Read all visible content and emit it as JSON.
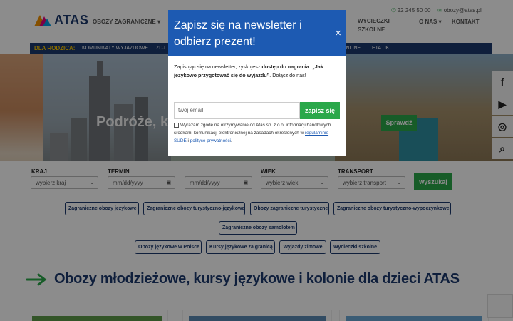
{
  "header": {
    "logo_text": "ATAS",
    "nav": [
      "OBOZY ZAGRANICZNE"
    ],
    "nav_right": [
      "WYCIECZKI",
      "SZKOLNE",
      "O NAS",
      "KONTAKT"
    ],
    "phone": "22 245 50 00",
    "email": "obozy@atas.pl"
  },
  "subnav": {
    "label": "DLA RODZICA:",
    "items": [
      "KOMUNIKATY WYJAZDOWE",
      "ZDJ",
      "ONLINE",
      "ETA UK"
    ]
  },
  "hero": {
    "text": "Podróże, kt",
    "button": "Sprawdź"
  },
  "search": {
    "kraj_label": "KRAJ",
    "kraj_value": "wybierz kraj",
    "termin_label": "TERMIN",
    "date_from": "mm/dd/yyyy",
    "date_to": "mm/dd/yyyy",
    "wiek_label": "WIEK",
    "wiek_value": "wybierz wiek",
    "transport_label": "TRANSPORT",
    "transport_value": "wybierz transport",
    "button": "wyszukaj"
  },
  "tags_row1": [
    "Zagraniczne obozy językowe",
    "Zagraniczne obozy turystyczno-językowe",
    "Obozy zagraniczne turystyczne",
    "Zagraniczne obozy turystyczno-wypoczynkowe"
  ],
  "tags_row2": [
    "Zagraniczne obozy samolotem"
  ],
  "tags_row3": [
    "Obozy językowe w Polsce",
    "Kursy językowe za granicą",
    "Wyjazdy zimowe",
    "Wycieczki szkolne"
  ],
  "main_title": "Obozy młodzieżowe, kursy językowe i kolonie dla dzieci ATAS",
  "modal": {
    "title": "Zapisz się na newsletter i odbierz prezent!",
    "close": "×",
    "text_pre": "Zapisując się na newsletter, zyskujesz ",
    "text_bold": "dostęp do nagrania: „Jak językowo przygotować się do wyjazdu”",
    "text_post": ". Dołącz do nas!",
    "email_placeholder": "twój email",
    "submit": "zapisz się",
    "consent_pre": "Wyrażam zgodę na otrzymywanie od Atas sp. z o.o. informacji handlowych środkami komunikacji elektronicznej na zasadach określonych w ",
    "consent_link1": "regulaminie ŚUDE",
    "consent_mid": " i ",
    "consent_link2": "polityce prywatności",
    "consent_post": "."
  },
  "social": [
    "f",
    "▶",
    "◎",
    "⌕"
  ],
  "colors": {
    "brand_blue": "#1d3a6e",
    "modal_blue": "#1d5ab2",
    "green": "#2aa84a",
    "yellow": "#f6c400"
  }
}
